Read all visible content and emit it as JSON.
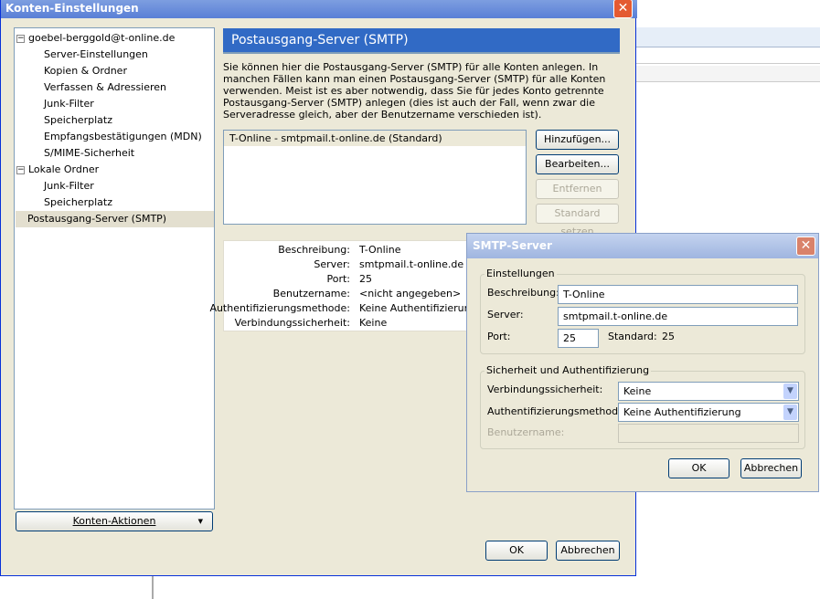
{
  "main_window": {
    "title": "Konten-Einstellungen",
    "tree": [
      {
        "label": "goebel-berggold@t-online.de",
        "level": 0,
        "toggle": "⊟"
      },
      {
        "label": "Server-Einstellungen",
        "level": 1
      },
      {
        "label": "Kopien & Ordner",
        "level": 1
      },
      {
        "label": "Verfassen & Adressieren",
        "level": 1
      },
      {
        "label": "Junk-Filter",
        "level": 1
      },
      {
        "label": "Speicherplatz",
        "level": 1
      },
      {
        "label": "Empfangsbestätigungen (MDN)",
        "level": 1
      },
      {
        "label": "S/MIME-Sicherheit",
        "level": 1
      },
      {
        "label": "Lokale Ordner",
        "level": 0,
        "toggle": "⊟"
      },
      {
        "label": "Junk-Filter",
        "level": 1
      },
      {
        "label": "Speicherplatz",
        "level": 1
      },
      {
        "label": "Postausgang-Server (SMTP)",
        "level": 0,
        "selected": true
      }
    ],
    "account_actions": "Konten-Aktionen",
    "header": "Postausgang-Server (SMTP)",
    "description": "Sie können hier die Postausgang-Server (SMTP) für alle Konten anlegen. In manchen Fällen kann man einen Postausgang-Server (SMTP) für alle Konten verwenden. Meist ist es aber notwendig, dass Sie für jedes Konto getrennte Postausgang-Server (SMTP) anlegen (dies ist auch der Fall, wenn zwar die Serveradresse gleich, aber der Benutzername verschieden ist).",
    "server_list": [
      "T-Online - smtpmail.t-online.de (Standard)"
    ],
    "buttons": {
      "add": "Hinzufügen...",
      "edit": "Bearbeiten...",
      "remove": "Entfernen",
      "set_default": "Standard setzen",
      "ok": "OK",
      "cancel": "Abbrechen"
    },
    "details": [
      {
        "label": "Beschreibung:",
        "value": "T-Online"
      },
      {
        "label": "Server:",
        "value": "smtpmail.t-online.de"
      },
      {
        "label": "Port:",
        "value": "25"
      },
      {
        "label": "Benutzername:",
        "value": "<nicht angegeben>"
      },
      {
        "label": "Authentifizierungsmethode:",
        "value": "Keine Authentifizierung"
      },
      {
        "label": "Verbindungssicherheit:",
        "value": "Keine"
      }
    ]
  },
  "smtp_dialog": {
    "title": "SMTP-Server",
    "settings_legend": "Einstellungen",
    "description_label": "Beschreibung:",
    "description_value": "T-Online",
    "server_label": "Server:",
    "server_value": "smtpmail.t-online.de",
    "port_label": "Port:",
    "port_value": "25",
    "default_label": "Standard:",
    "default_value": "25",
    "security_legend": "Sicherheit und Authentifizierung",
    "conn_security_label": "Verbindungssicherheit:",
    "conn_security_value": "Keine",
    "auth_label": "Authentifizierungsmethode:",
    "auth_value": "Keine Authentifizierung",
    "username_label": "Benutzername:",
    "username_value": "",
    "ok": "OK",
    "cancel": "Abbrechen"
  }
}
